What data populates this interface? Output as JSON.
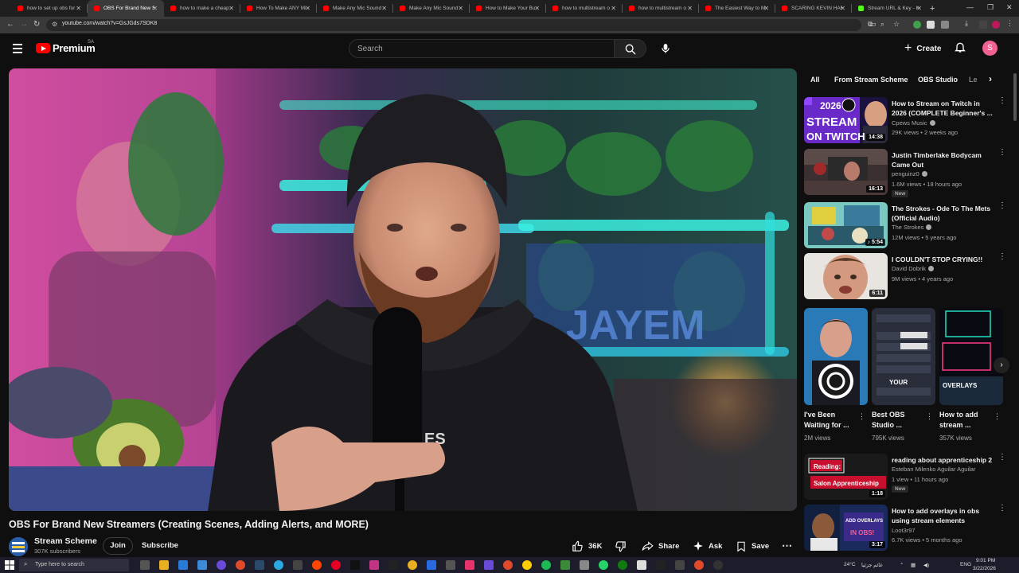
{
  "browser": {
    "tabs": [
      {
        "title": "how to set up obs for",
        "fav": "youtube"
      },
      {
        "title": "OBS For Brand New St",
        "fav": "youtube",
        "active": true
      },
      {
        "title": "how to make a cheap",
        "fav": "youtube"
      },
      {
        "title": "How To Make ANY Mi",
        "fav": "youtube"
      },
      {
        "title": "Make Any Mic Sound",
        "fav": "youtube"
      },
      {
        "title": "Make Any Mic Sound",
        "fav": "youtube"
      },
      {
        "title": "How to Make Your Bu",
        "fav": "youtube"
      },
      {
        "title": "how to multistream o",
        "fav": "youtube"
      },
      {
        "title": "how to multistream o",
        "fav": "youtube"
      },
      {
        "title": "The Easiest Way to M",
        "fav": "youtube"
      },
      {
        "title": "SCARING KEVIN HART",
        "fav": "youtube"
      },
      {
        "title": "Stream URL & Key - K",
        "fav": "kick"
      }
    ],
    "new_tab": "+",
    "url": "youtube.com/watch?v=GsJGds7SDK8"
  },
  "header": {
    "brand": "Premium",
    "region": "SA",
    "search_placeholder": "Search",
    "create_label": "Create",
    "avatar_letter": "S"
  },
  "video": {
    "title": "OBS For Brand New Streamers (Creating Scenes, Adding Alerts, and MORE)",
    "channel": "Stream Scheme",
    "subscribers": "307K subscribers",
    "join_label": "Join",
    "subscribe_label": "Subscribe",
    "likes": "36K",
    "share_label": "Share",
    "ask_label": "Ask",
    "save_label": "Save",
    "overlay_text_1": "JAYEM",
    "overlay_text_2": "ES"
  },
  "sidebar": {
    "chips": [
      "All",
      "From Stream Scheme",
      "OBS Studio",
      "Le"
    ],
    "videos": [
      {
        "title": "How to Stream on Twitch in 2026 (COMPLETE Beginner's ...",
        "channel": "Cpews Music",
        "meta": "29K views • 2 weeks ago",
        "duration": "14:38",
        "thumb_text_1": "2026",
        "thumb_text_2": "STREAM",
        "thumb_text_3": "ON TWITCH"
      },
      {
        "title": "Justin Timberlake Bodycam Came Out",
        "channel": "penguinz0",
        "meta": "1.6M views • 18 hours ago",
        "duration": "16:13",
        "badge": "New"
      },
      {
        "title": "The Strokes - Ode To The Mets (Official Audio)",
        "channel": "The Strokes",
        "meta": "12M views • 5 years ago",
        "duration": "5:54"
      },
      {
        "title": "I COULDN'T STOP CRYING!!",
        "channel": "David Dobrik",
        "meta": "9M views • 4 years ago",
        "duration": "6:11"
      },
      {
        "title": "reading about apprenticeship 2",
        "channel": "Esteban Milenko Aguilar Aguilar",
        "meta": "1 view • 11 hours ago",
        "duration": "1:18",
        "badge": "New",
        "thumb_text_1": "Reading:",
        "thumb_text_2": "Salon Apprenticeship"
      },
      {
        "title": "How to add overlays in obs using stream elements",
        "channel": "Loot3r97",
        "meta": "6.7K views • 5 months ago",
        "duration": "3:17",
        "thumb_text_1": "ADD OVERLAYS",
        "thumb_text_2": "IN OBS!"
      }
    ],
    "shorts": [
      {
        "title": "I've Been Waiting for ...",
        "views": "2M views"
      },
      {
        "title": "Best OBS Studio ...",
        "views": "795K views",
        "thumb_text": "YOUR"
      },
      {
        "title": "How to add stream ...",
        "views": "357K views",
        "thumb_text": "OVERLAYS"
      }
    ]
  },
  "taskbar": {
    "search_placeholder": "Type here to search",
    "temperature": "24°C",
    "weather": "غائم جزئيا",
    "language": "ENG",
    "time": "9:01 PM",
    "date": "3/22/2026"
  },
  "colors": {
    "brand_red": "#ff0000",
    "background": "#0f0f0f",
    "kick_green": "#53fc18"
  }
}
